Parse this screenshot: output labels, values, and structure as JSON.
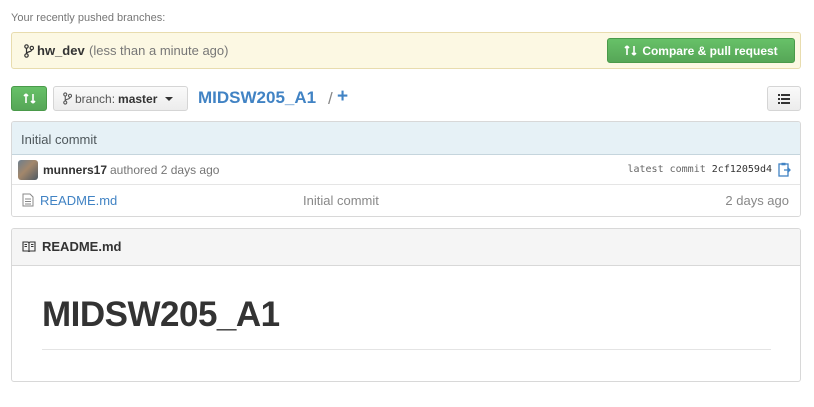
{
  "recent": {
    "label": "Your recently pushed branches:",
    "branch": "hw_dev",
    "time": "(less than a minute ago)",
    "compare_button": "Compare & pull request"
  },
  "toolbar": {
    "branch_prefix": "branch:",
    "branch_name": "master",
    "repo_name": "MIDSW205_A1",
    "separator": "/",
    "add": "+"
  },
  "commit": {
    "message": "Initial commit",
    "author": "munners17",
    "authored": "authored 2 days ago",
    "latest_label": "latest commit",
    "sha": "2cf12059d4"
  },
  "files": [
    {
      "name": "README.md",
      "message": "Initial commit",
      "age": "2 days ago"
    }
  ],
  "readme": {
    "title": "README.md",
    "heading": "MIDSW205_A1"
  },
  "colors": {
    "link": "#4183c4",
    "green": "#56a657",
    "notice_bg": "#fcf8e3",
    "commit_bar_bg": "#e6f1f6"
  },
  "icons": [
    "git-branch-icon",
    "compare-icon",
    "list-icon",
    "clipboard-icon",
    "file-icon",
    "book-icon"
  ]
}
